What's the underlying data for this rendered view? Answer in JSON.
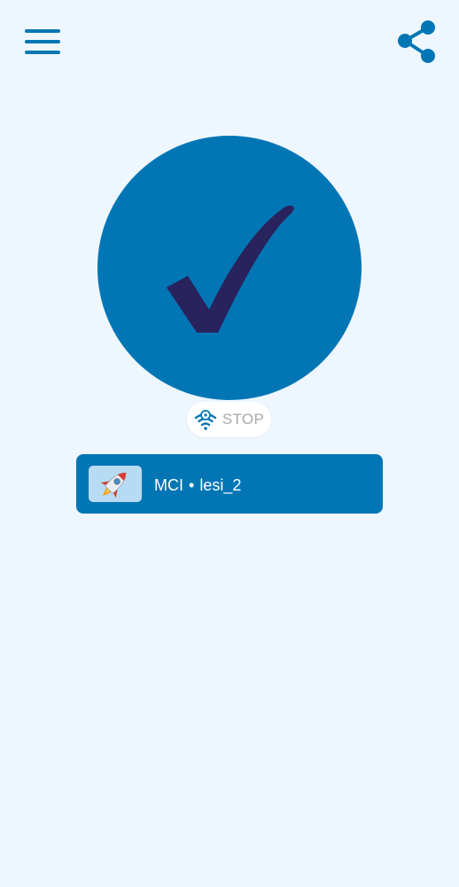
{
  "icons": {
    "menu": "hamburger-menu-icon",
    "share": "share-icon",
    "connect": "checkmark-icon",
    "stop": "wifi-settings-icon",
    "server": "rocket-icon"
  },
  "colors": {
    "background": "#eef7ff",
    "primary": "#0276b5",
    "check": "#28225d",
    "stop_text": "#a9a9a9",
    "card_thumb": "#b7dbf2"
  },
  "stop": {
    "label": "STOP"
  },
  "server": {
    "operator": "MCI",
    "separator": "•",
    "name": "lesi_2"
  }
}
